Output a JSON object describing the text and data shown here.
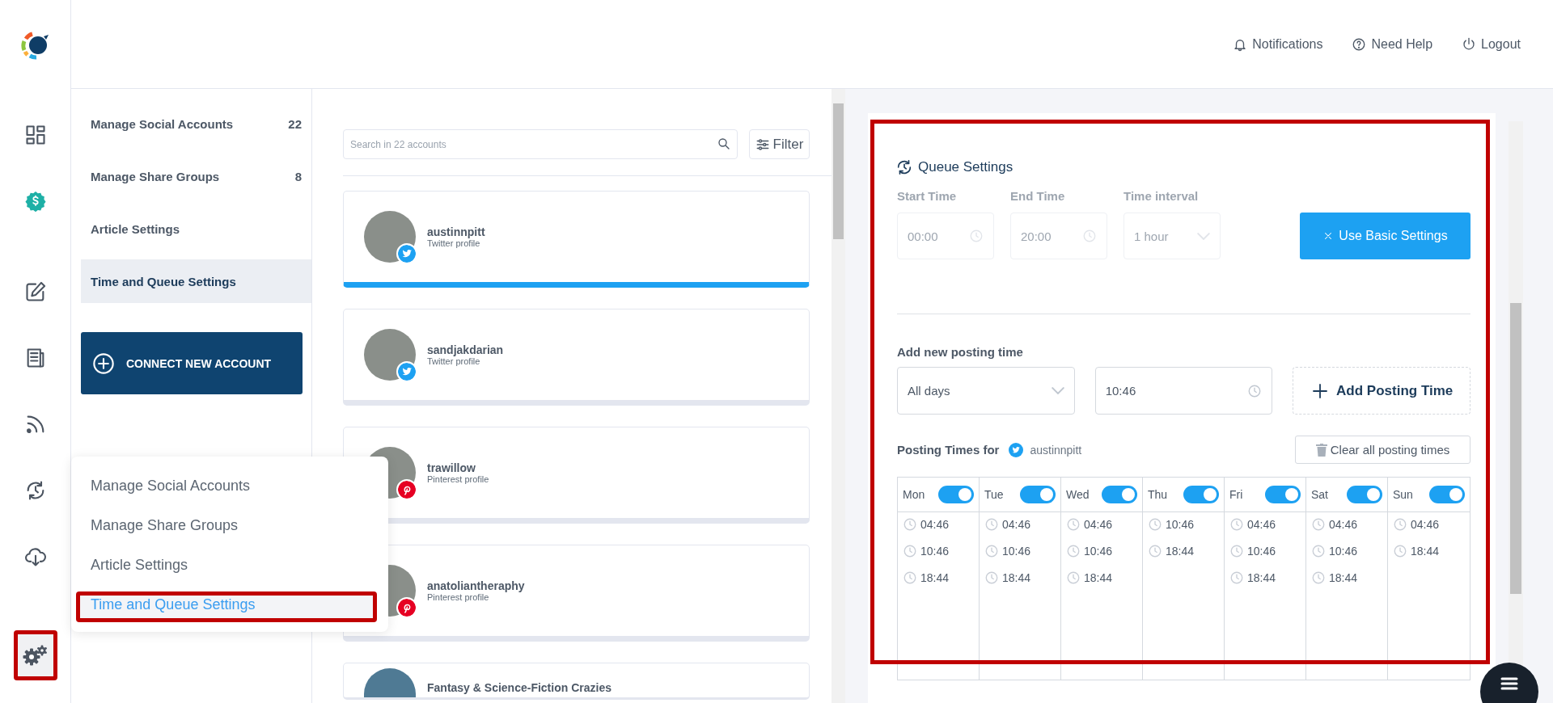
{
  "rail": {
    "items": [
      {
        "kind": "dashboard",
        "selected": false,
        "highlighted": false
      },
      {
        "kind": "billing",
        "selected": false,
        "highlighted": false
      },
      {
        "kind": "compose",
        "selected": false,
        "highlighted": false
      },
      {
        "kind": "articles",
        "selected": false,
        "highlighted": false
      },
      {
        "kind": "feeds",
        "selected": false,
        "highlighted": false
      },
      {
        "kind": "queue",
        "selected": false,
        "highlighted": false
      },
      {
        "kind": "import",
        "selected": false,
        "highlighted": false
      },
      {
        "kind": "settings",
        "selected": true,
        "highlighted": true
      }
    ]
  },
  "header": {
    "links": [
      {
        "kind": "bell",
        "label": "Notifications"
      },
      {
        "kind": "help",
        "label": "Need Help"
      },
      {
        "kind": "power",
        "label": "Logout"
      }
    ]
  },
  "submenu": {
    "items": [
      {
        "label": "Manage Social Accounts",
        "count": "22",
        "selected": false
      },
      {
        "label": "Manage Share Groups",
        "count": "8",
        "selected": false
      },
      {
        "label": "Article Settings",
        "selected": false
      },
      {
        "label": "Time and Queue Settings",
        "selected": true
      }
    ],
    "connect_button": "CONNECT NEW ACCOUNT"
  },
  "popup_menu": {
    "items": [
      {
        "label": "Manage Social Accounts",
        "selected": false,
        "highlighted": false
      },
      {
        "label": "Manage Share Groups",
        "selected": false,
        "highlighted": false
      },
      {
        "label": "Article Settings",
        "selected": false,
        "highlighted": false
      },
      {
        "label": "Time and Queue Settings",
        "selected": true,
        "highlighted": true
      }
    ]
  },
  "accounts": {
    "search": {
      "placeholder": "Search in 22 accounts"
    },
    "filter": "Filter",
    "items": [
      {
        "name": "austinnpitt",
        "type": "Twitter profile",
        "kind": "twitter",
        "selected": true
      },
      {
        "name": "sandjakdarian",
        "type": "Twitter profile",
        "kind": "twitter",
        "selected": false
      },
      {
        "name": "trawillow",
        "type": "Pinterest profile",
        "kind": "pinterest",
        "selected": false
      },
      {
        "name": "anatoliantheraphy",
        "type": "Pinterest profile",
        "kind": "pinterest",
        "selected": false
      },
      {
        "name": "Fantasy & Science-Fiction Crazies",
        "selected": false
      }
    ]
  },
  "queue": {
    "highlighted": true,
    "title": "Queue Settings",
    "fields": [
      {
        "label": "Start Time",
        "value": "00:00",
        "kind": "time",
        "disabled": true
      },
      {
        "label": "End Time",
        "value": "20:00",
        "kind": "time",
        "disabled": true
      },
      {
        "label": "Time interval",
        "value": "1 hour",
        "kind": "select",
        "disabled": true
      }
    ],
    "basic_button": "Use Basic Settings",
    "add_label": "Add new posting time",
    "day_select": "All days",
    "time_value": "10:46",
    "add_button": "Add Posting Time",
    "posting_title": "Posting Times for",
    "posting_account": "austinnpitt",
    "clear_button": "Clear all posting times",
    "days": [
      {
        "name": "Mon",
        "on": true,
        "times": [
          "04:46",
          "10:46",
          "18:44"
        ]
      },
      {
        "name": "Tue",
        "on": true,
        "times": [
          "04:46",
          "10:46",
          "18:44"
        ]
      },
      {
        "name": "Wed",
        "on": true,
        "times": [
          "04:46",
          "10:46",
          "18:44"
        ]
      },
      {
        "name": "Thu",
        "on": true,
        "times": [
          "10:46",
          "18:44"
        ]
      },
      {
        "name": "Fri",
        "on": true,
        "times": [
          "04:46",
          "10:46",
          "18:44"
        ]
      },
      {
        "name": "Sat",
        "on": true,
        "times": [
          "04:46",
          "10:46",
          "18:44"
        ]
      },
      {
        "name": "Sun",
        "on": true,
        "times": [
          "04:46",
          "18:44"
        ]
      }
    ]
  }
}
